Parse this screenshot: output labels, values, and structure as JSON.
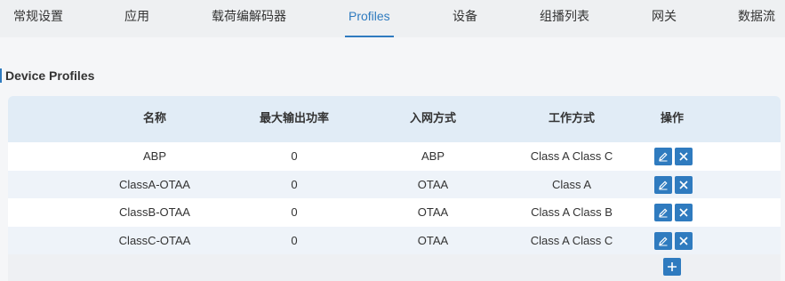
{
  "tabs": [
    {
      "label": "常规设置"
    },
    {
      "label": "应用"
    },
    {
      "label": "载荷编解码器"
    },
    {
      "label": "Profiles"
    },
    {
      "label": "设备"
    },
    {
      "label": "组播列表"
    },
    {
      "label": "网关"
    },
    {
      "label": "数据流"
    }
  ],
  "active_tab": "Profiles",
  "section": {
    "title": "Device Profiles"
  },
  "table": {
    "headers": [
      "名称",
      "最大输出功率",
      "入网方式",
      "工作方式",
      "操作"
    ],
    "rows": [
      {
        "name": "ABP",
        "max_power": "0",
        "join_type": "ABP",
        "class_mode": "Class A Class C"
      },
      {
        "name": "ClassA-OTAA",
        "max_power": "0",
        "join_type": "OTAA",
        "class_mode": "Class A"
      },
      {
        "name": "ClassB-OTAA",
        "max_power": "0",
        "join_type": "OTAA",
        "class_mode": "Class A Class B"
      },
      {
        "name": "ClassC-OTAA",
        "max_power": "0",
        "join_type": "OTAA",
        "class_mode": "Class A Class C"
      }
    ]
  },
  "icons": {
    "edit": "pencil-icon",
    "delete": "close-icon",
    "add": "plus-icon"
  },
  "colors": {
    "accent": "#2f7bbf",
    "header_bg": "#e1ecf6"
  }
}
